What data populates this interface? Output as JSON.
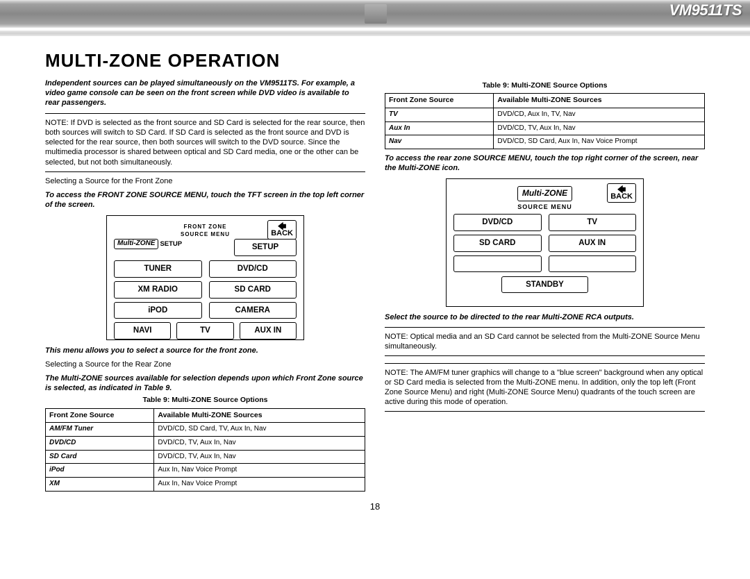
{
  "header": {
    "model": "VM9511TS"
  },
  "title": "Multi-Zone Operation",
  "left": {
    "intro": "Independent sources can be played simultaneously on the VM9511TS. For example, a video game console can be seen on the front screen while DVD video is available to rear passengers.",
    "note1": "NOTE: If DVD is selected as the front source and SD Card is selected for the rear source, then both sources will switch to SD Card. If SD Card is selected as the front source and DVD is selected for the rear source, then both sources will switch to the DVD source. Since the multimedia processor is shared between optical and SD Card media, one or the other can be selected, but not both simultaneously.",
    "sub1": "Selecting a Source for the Front Zone",
    "access1": "To access the FRONT ZONE SOURCE MENU, touch the TFT screen in the top left corner of the screen.",
    "frontmenu": {
      "pill": "Multi-ZONE",
      "setup1": "SETUP",
      "title1": "FRONT ZONE",
      "title2": "SOURCE MENU",
      "setup_btn": "SETUP",
      "back": "BACK",
      "buttons": [
        "TUNER",
        "DVD/CD",
        "XM RADIO",
        "SD CARD",
        "iPOD",
        "CAMERA"
      ],
      "row3": [
        "NAVI",
        "TV",
        "AUX IN"
      ]
    },
    "caption_after_menu": "This menu allows you to select a source for the front zone.",
    "sub2": "Selecting a Source for the Rear Zone",
    "access2": "The Multi-ZONE sources available for selection depends upon which Front Zone source is selected, as indicated in Table 9.",
    "table1_caption": "Table 9: Multi-ZONE Source Options",
    "table1": {
      "head": [
        "Front Zone Source",
        "Available Multi-ZONE Sources"
      ],
      "rows": [
        [
          "AM/FM Tuner",
          "DVD/CD, SD Card, TV, Aux In, Nav"
        ],
        [
          "DVD/CD",
          "DVD/CD, TV, Aux In, Nav"
        ],
        [
          "SD Card",
          "DVD/CD, TV, Aux In, Nav"
        ],
        [
          "iPod",
          "Aux In, Nav Voice Prompt"
        ],
        [
          "XM",
          "Aux In, Nav Voice Prompt"
        ]
      ]
    }
  },
  "right": {
    "table2_caption": "Table 9: Multi-ZONE Source Options",
    "table2": {
      "head": [
        "Front Zone Source",
        "Available Multi-ZONE Sources"
      ],
      "rows": [
        [
          "TV",
          "DVD/CD, Aux In, TV, Nav"
        ],
        [
          "Aux In",
          "DVD/CD, TV, Aux In, Nav"
        ],
        [
          "Nav",
          "DVD/CD, SD Card, Aux In, Nav Voice Prompt"
        ]
      ]
    },
    "access_rear": "To access the rear zone SOURCE MENU, touch the top right corner of the screen, near the Multi-ZONE icon.",
    "rearmenu": {
      "pill": "Multi-ZONE",
      "back": "BACK",
      "titlebar": "SOURCE MENU",
      "row1": [
        "DVD/CD",
        "TV"
      ],
      "row2": [
        "SD CARD",
        "AUX IN"
      ],
      "row3": [
        "",
        ""
      ],
      "standby": "STANDBY"
    },
    "select_caption": "Select the source to be directed to the rear Multi-ZONE RCA outputs.",
    "note2": "NOTE: Optical media and an SD Card cannot be selected from the Multi-ZONE Source Menu simultaneously.",
    "note3": "NOTE: The AM/FM tuner graphics will change to a \"blue screen\" background when any optical or SD Card media is selected from the Multi-ZONE menu. In addition, only the top left (Front Zone Source Menu) and right (Multi-ZONE Source Menu) quadrants of the touch screen are active during this mode of operation."
  },
  "page_number": "18"
}
